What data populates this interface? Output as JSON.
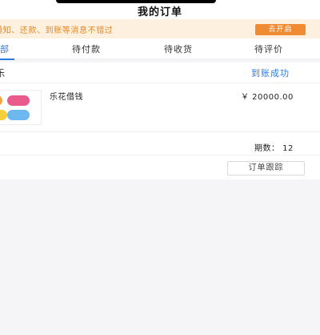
{
  "header": {
    "title": "我的订单"
  },
  "notice": {
    "text": "通知、还款、到账等消息不错过",
    "button_label": "去开启"
  },
  "tabs": [
    {
      "label": "全部"
    },
    {
      "label": "待付款"
    },
    {
      "label": "待收货"
    },
    {
      "label": "待评价"
    }
  ],
  "order": {
    "shop_name": "乐",
    "status": "到账成功",
    "product_name": "乐花借钱",
    "price": "￥ 20000.00",
    "period": "期数： 12",
    "track_button": "订单跟踪"
  },
  "colors": {
    "accent_blue": "#2c7be5",
    "notice_orange": "#ef8b33",
    "notice_bg": "#fdf0df"
  }
}
